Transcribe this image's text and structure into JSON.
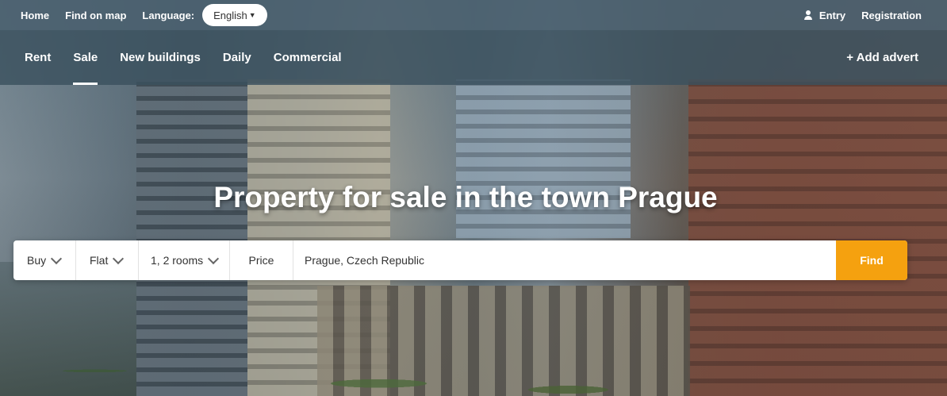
{
  "topbar": {
    "home": "Home",
    "find_on_map": "Find on map",
    "language_label": "Language:",
    "language_value": "English",
    "entry": "Entry",
    "registration": "Registration"
  },
  "nav": {
    "tabs": [
      {
        "label": "Rent",
        "active": false
      },
      {
        "label": "Sale",
        "active": true
      },
      {
        "label": "New buildings",
        "active": false
      },
      {
        "label": "Daily",
        "active": false
      },
      {
        "label": "Commercial",
        "active": false
      }
    ],
    "add_advert": "+ Add advert"
  },
  "hero": {
    "title": "Property for sale in the town Prague"
  },
  "search": {
    "deal_type": "Buy",
    "property_type": "Flat",
    "rooms": "1, 2 rooms",
    "price": "Price",
    "location_value": "Prague, Czech Republic",
    "find_label": "Find"
  },
  "colors": {
    "accent": "#f5a10f",
    "topbar_bg": "#4a606e",
    "navbar_bg": "#3a505e"
  },
  "icons": {
    "user": "user-icon",
    "dropdown": "chevron-down-icon",
    "language_caret": "caret-down-icon"
  }
}
